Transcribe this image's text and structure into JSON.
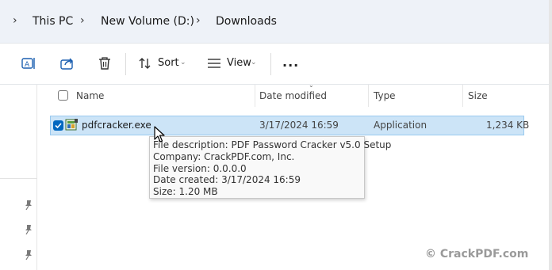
{
  "breadcrumb": {
    "items": [
      "This PC",
      "New Volume (D:)",
      "Downloads"
    ]
  },
  "toolbar": {
    "rename_icon": "rename-icon",
    "share_icon": "share-icon",
    "delete_icon": "trash-icon",
    "sort_label": "Sort",
    "view_label": "View",
    "more_label": "..."
  },
  "columns": {
    "name": "Name",
    "date_modified": "Date modified",
    "type": "Type",
    "size": "Size"
  },
  "files": [
    {
      "name": "pdfcracker.exe",
      "date_modified": "3/17/2024 16:59",
      "type": "Application",
      "size": "1,234 KB",
      "selected": true
    }
  ],
  "tooltip": {
    "lines": [
      "File description: PDF Password Cracker v5.0 Setup",
      "Company: CrackPDF.com, Inc.",
      "File version: 0.0.0.0",
      "Date created: 3/17/2024 16:59",
      "Size: 1.20 MB"
    ]
  },
  "watermark": "© CrackPDF.com",
  "colors": {
    "selection_bg": "#cce4f7",
    "selection_border": "#99c9ef",
    "checkbox_accent": "#0067c0",
    "address_bar_bg": "#eef2f8"
  }
}
